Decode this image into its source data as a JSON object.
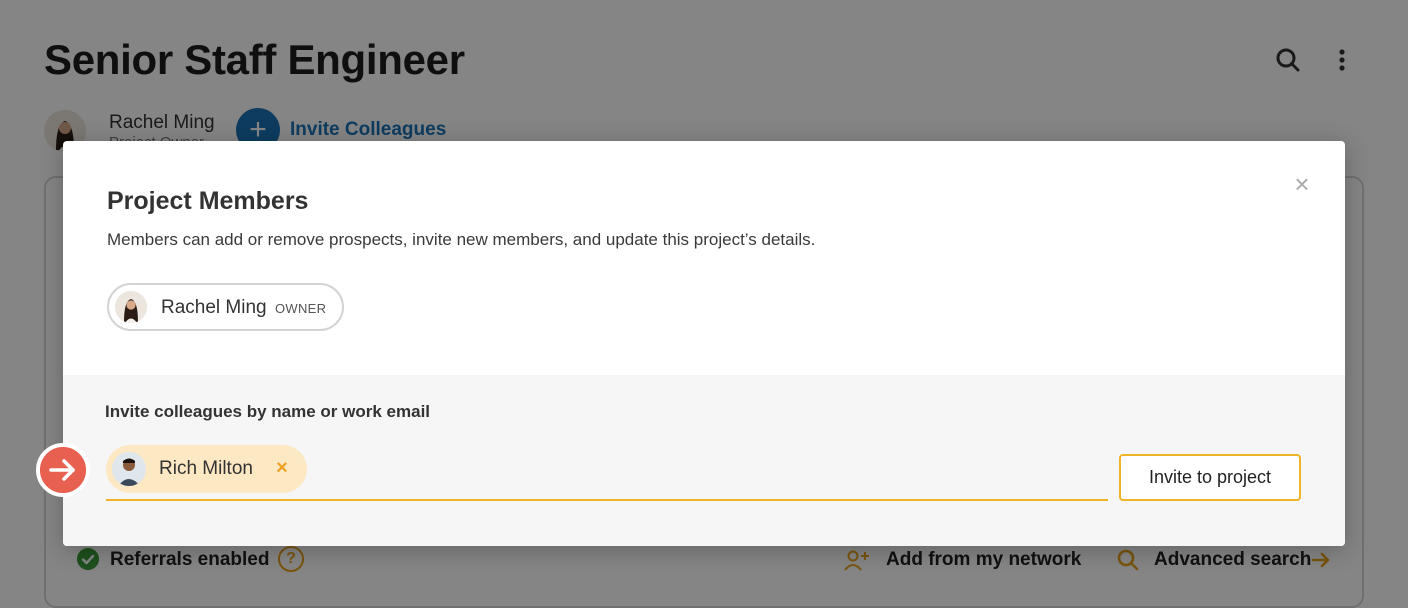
{
  "page": {
    "title": "Senior Staff Engineer",
    "owner": {
      "name": "Rachel Ming",
      "role": "Project Owner"
    },
    "invite_colleagues_label": "Invite Colleagues",
    "footer": {
      "referrals_label": "Referrals enabled",
      "add_network_label": "Add from my network",
      "advanced_search_label": "Advanced search"
    }
  },
  "modal": {
    "title": "Project Members",
    "description": "Members can add or remove prospects, invite new members, and update this project’s details.",
    "members": [
      {
        "name": "Rachel Ming",
        "role": "OWNER"
      }
    ],
    "invite": {
      "label": "Invite colleagues by name or work email",
      "invitees": [
        {
          "name": "Rich Milton"
        }
      ],
      "button_label": "Invite to project"
    }
  },
  "colors": {
    "accent": "#f0b429",
    "link_blue": "#1a73b8",
    "pointer": "#e8604f",
    "success": "#3a9a3a"
  }
}
